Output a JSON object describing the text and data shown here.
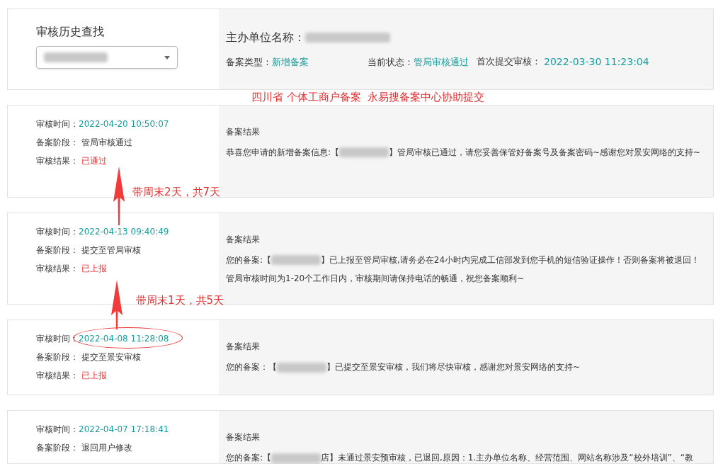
{
  "search": {
    "title": "审核历史查找"
  },
  "summary": {
    "org_label": "主办单位名称：",
    "type_label": "备案类型：",
    "type_value": "新增备案",
    "state_label": "当前状态：",
    "state_value": "管局审核通过",
    "first_label": "首次提交审核：",
    "first_value": "2022-03-30 11:23:04"
  },
  "banner": "四川省 个体工商户备案  永易搜备案中心协助提交",
  "records": [
    {
      "time_label": "审核时间：",
      "time": "2022-04-20 10:50:07",
      "stage_label": "备案阶段：",
      "stage": "管局审核通过",
      "result_label": "审核结果：",
      "result": "已通过",
      "heading": "备案结果",
      "before": "恭喜您申请的新增备案信息:【",
      "after": "】管局审核已通过，请您妥善保管好备案号及备案密码~感谢您对景安网络的支持~",
      "circled": false
    },
    {
      "time_label": "审核时间：",
      "time": "2022-04-13 09:40:49",
      "stage_label": "备案阶段：",
      "stage": "提交至管局审核",
      "result_label": "审核结果：",
      "result": "已上报",
      "heading": "备案结果",
      "before": "您的备案:【",
      "after": "】已上报至管局审核,请务必在24小时内完成工信部发到您手机的短信验证操作！否则备案将被退回！管局审核时间为1-20个工作日内，审核期间请保持电话的畅通，祝您备案顺利~",
      "circled": false
    },
    {
      "time_label": "审核时间：",
      "time": "2022-04-08 11:28:08",
      "stage_label": "备案阶段：",
      "stage": "提交至景安审核",
      "result_label": "审核结果：",
      "result": "已上报",
      "heading": "备案结果",
      "before": "您的备案：【",
      "after": "】已提交至景安审核，我们将尽快审核，感谢您对景安网络的支持~",
      "circled": true
    },
    {
      "time_label": "审核时间：",
      "time": "2022-04-07 17:18:41",
      "stage_label": "备案阶段：",
      "stage": "退回用户修改",
      "heading": "备案结果",
      "before": "您的备案:【",
      "after": "店】未通过景安预审核，已退回,原因：1.主办单位名称、经营范围、网站名称涉及“校外培训”、“教",
      "circled": false
    }
  ],
  "notes": [
    {
      "text": "带周末2天，共7天"
    },
    {
      "text": "带周末1天，共5天"
    }
  ]
}
